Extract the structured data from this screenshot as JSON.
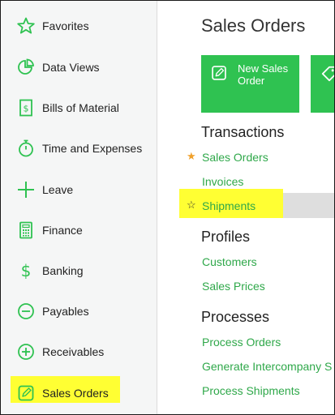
{
  "sidebar": {
    "items": [
      {
        "label": "Favorites",
        "icon": "star-icon"
      },
      {
        "label": "Data Views",
        "icon": "pie-chart-icon"
      },
      {
        "label": "Bills of Material",
        "icon": "document-dollar-icon"
      },
      {
        "label": "Time and Expenses",
        "icon": "stopwatch-icon"
      },
      {
        "label": "Leave",
        "icon": "plus-icon"
      },
      {
        "label": "Finance",
        "icon": "calculator-icon"
      },
      {
        "label": "Banking",
        "icon": "dollar-icon"
      },
      {
        "label": "Payables",
        "icon": "minus-circle-icon"
      },
      {
        "label": "Receivables",
        "icon": "plus-circle-icon"
      },
      {
        "label": "Sales Orders",
        "icon": "edit-icon",
        "active": true
      }
    ]
  },
  "main": {
    "title": "Sales Orders",
    "tiles": [
      {
        "label": "New Sales Order",
        "icon": "edit-icon"
      },
      {
        "label": "",
        "icon": "tag-icon"
      }
    ],
    "sections": [
      {
        "title": "Transactions",
        "links": [
          "Sales Orders",
          "Invoices",
          "Shipments"
        ]
      },
      {
        "title": "Profiles",
        "links": [
          "Customers",
          "Sales Prices"
        ]
      },
      {
        "title": "Processes",
        "links": [
          "Process Orders",
          "Generate Intercompany S",
          "Process Shipments"
        ]
      }
    ],
    "favorite_link": "Sales Orders",
    "hovered_link": "Shipments"
  },
  "colors": {
    "accent": "#2fc251",
    "link": "#2fa84a",
    "star": "#f0a02a",
    "highlight": "#ffff33",
    "sidebar_bg": "#f5f6f6"
  }
}
